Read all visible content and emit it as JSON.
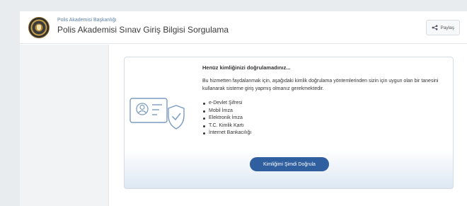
{
  "header": {
    "supertitle": "Polis Akademisi Başkanlığı",
    "title": "Polis Akademisi Sınav Giriş Bilgisi Sorgulama",
    "share_label": "Paylaş",
    "share_icon": "share-icon",
    "logo_icon": "emblem-logo"
  },
  "card": {
    "heading": "Henüz kimliğinizi doğrulamadınız...",
    "description": "Bu hizmetten faydalanmak için, aşağıdaki kimlik doğrulama yöntemlerinden sizin için uygun olan bir tanesini kullanarak sisteme giriş yapmış olmanız gerekmektedir.",
    "methods": [
      "e-Devlet Şifresi",
      "Mobil İmza",
      "Elektronik İmza",
      "T.C. Kimlik Kartı",
      "İnternet Bankacılığı"
    ],
    "button_label": "Kimliğimi Şimdi Doğrula",
    "illustration_icon": "id-card-shield-icon"
  },
  "colors": {
    "page_background": "#e9ecef",
    "primary_button": "#2f5f9e",
    "illustration_stroke": "#7b9cc0",
    "supertitle": "#5a7fa7"
  }
}
